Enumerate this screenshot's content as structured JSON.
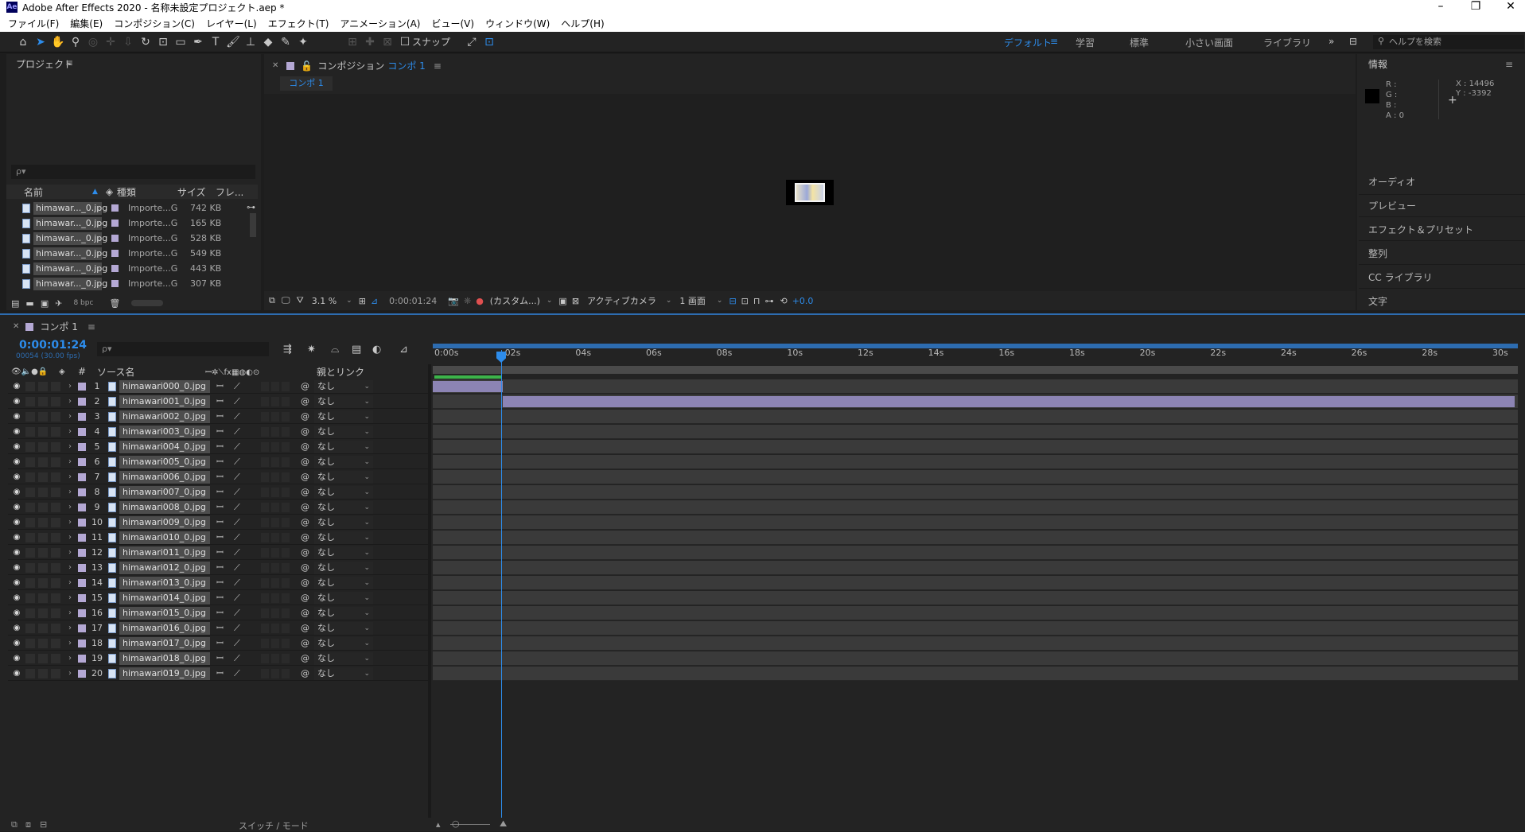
{
  "app": {
    "title": "Adobe After Effects 2020 - 名称未設定プロジェクト.aep *",
    "logo": "Ae"
  },
  "menu": [
    "ファイル(F)",
    "編集(E)",
    "コンポジション(C)",
    "レイヤー(L)",
    "エフェクト(T)",
    "アニメーション(A)",
    "ビュー(V)",
    "ウィンドウ(W)",
    "ヘルプ(H)"
  ],
  "toolbar": {
    "snap_label": "スナップ"
  },
  "workspaces": {
    "default": "デフォルト",
    "learn": "学習",
    "standard": "標準",
    "small": "小さい画面",
    "library": "ライブラリ",
    "more": "»"
  },
  "help_search": {
    "placeholder": "ヘルプを検索"
  },
  "project": {
    "title": "プロジェクト",
    "search_icon": "ρ▾",
    "columns": {
      "name": "名前",
      "type": "種類",
      "size": "サイズ",
      "frame": "フレ..."
    },
    "items": [
      {
        "name": "himawar..._0.jpg",
        "type": "Importe...G",
        "size": "742 KB"
      },
      {
        "name": "himawar..._0.jpg",
        "type": "Importe...G",
        "size": "165 KB"
      },
      {
        "name": "himawar..._0.jpg",
        "type": "Importe...G",
        "size": "528 KB"
      },
      {
        "name": "himawar..._0.jpg",
        "type": "Importe...G",
        "size": "549 KB"
      },
      {
        "name": "himawar..._0.jpg",
        "type": "Importe...G",
        "size": "443 KB"
      },
      {
        "name": "himawar..._0.jpg",
        "type": "Importe...G",
        "size": "307 KB"
      }
    ],
    "bpc": "8 bpc"
  },
  "composition": {
    "panel_label": "コンポジション",
    "comp_name": "コンポ 1",
    "tab_label": "コンポ 1",
    "zoom": "3.1 %",
    "timecode": "0:00:01:24",
    "resolution": "(カスタム...)",
    "camera": "アクティブカメラ",
    "views": "1 画面",
    "exposure": "+0.0"
  },
  "info": {
    "title": "情報",
    "r": "R :",
    "g": "G :",
    "b": "B :",
    "a": "A : 0",
    "x": "X : 14496",
    "y": "Y : -3392"
  },
  "side_panels": [
    "オーディオ",
    "プレビュー",
    "エフェクト＆プリセット",
    "整列",
    "CC ライブラリ",
    "文字"
  ],
  "timeline": {
    "comp_tab": "コンポ 1",
    "timecode": "0:00:01:24",
    "timecode_sub": "00054 (30.00 fps)",
    "columns": {
      "num": "#",
      "source": "ソース名",
      "parent": "親とリンク"
    },
    "parent_value": "なし",
    "layers": [
      {
        "num": "1",
        "name": "himawari000_0.jpg"
      },
      {
        "num": "2",
        "name": "himawari001_0.jpg"
      },
      {
        "num": "3",
        "name": "himawari002_0.jpg"
      },
      {
        "num": "4",
        "name": "himawari003_0.jpg"
      },
      {
        "num": "5",
        "name": "himawari004_0.jpg"
      },
      {
        "num": "6",
        "name": "himawari005_0.jpg"
      },
      {
        "num": "7",
        "name": "himawari006_0.jpg"
      },
      {
        "num": "8",
        "name": "himawari007_0.jpg"
      },
      {
        "num": "9",
        "name": "himawari008_0.jpg"
      },
      {
        "num": "10",
        "name": "himawari009_0.jpg"
      },
      {
        "num": "11",
        "name": "himawari010_0.jpg"
      },
      {
        "num": "12",
        "name": "himawari011_0.jpg"
      },
      {
        "num": "13",
        "name": "himawari012_0.jpg"
      },
      {
        "num": "14",
        "name": "himawari013_0.jpg"
      },
      {
        "num": "15",
        "name": "himawari014_0.jpg"
      },
      {
        "num": "16",
        "name": "himawari015_0.jpg"
      },
      {
        "num": "17",
        "name": "himawari016_0.jpg"
      },
      {
        "num": "18",
        "name": "himawari017_0.jpg"
      },
      {
        "num": "19",
        "name": "himawari018_0.jpg"
      },
      {
        "num": "20",
        "name": "himawari019_0.jpg"
      }
    ],
    "ruler_ticks": [
      "0:00s",
      "02s",
      "04s",
      "06s",
      "08s",
      "10s",
      "12s",
      "14s",
      "16s",
      "18s",
      "20s",
      "22s",
      "24s",
      "26s",
      "28s",
      "30s"
    ],
    "switch_mode": "スイッチ / モード"
  },
  "colors": {
    "accent": "#2d8ceb",
    "label_lavender": "#b4a8d4",
    "layer_bar": "#8c84b4"
  }
}
